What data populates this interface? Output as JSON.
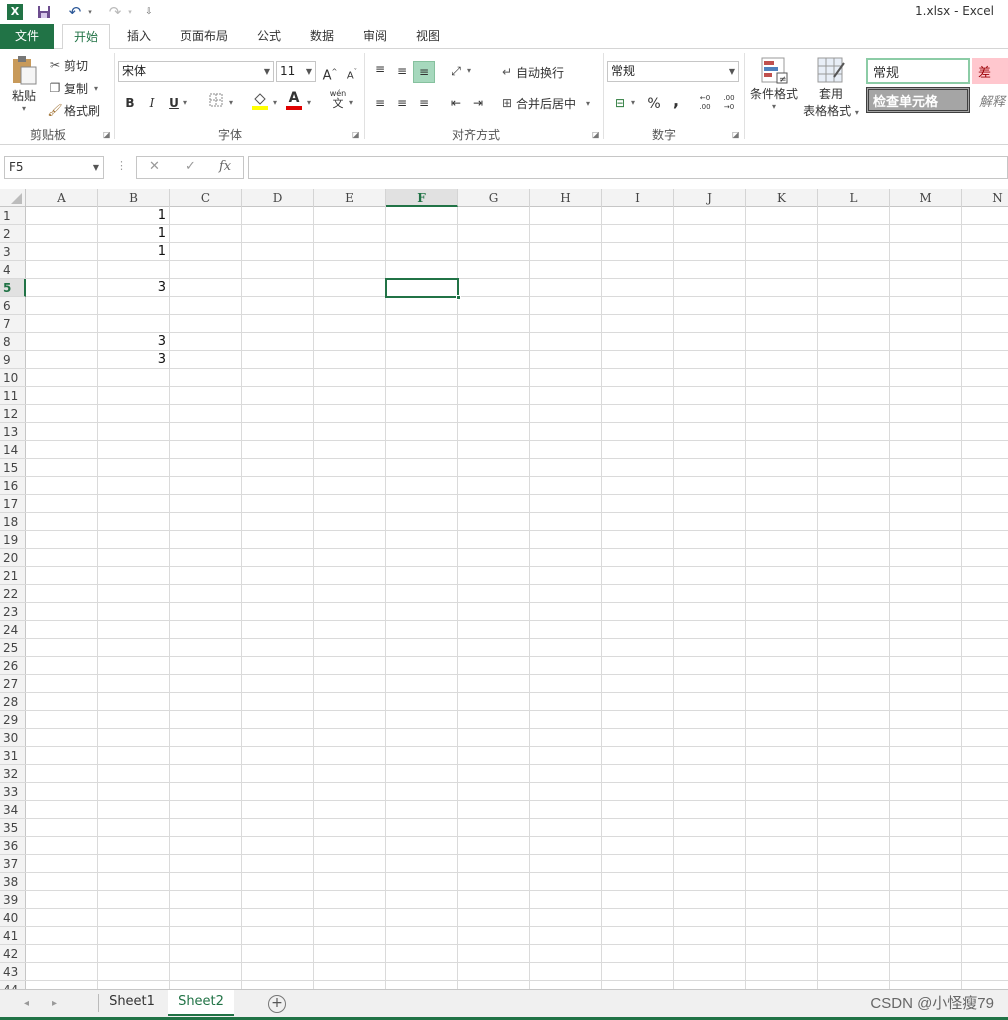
{
  "titlebar": {
    "title": "1.xlsx - Excel",
    "excel_logo": "X",
    "save_icon": "save-icon",
    "undo_glyph": "↶",
    "redo_glyph": "↷",
    "customize_glyph": "⇩"
  },
  "tabs": [
    "文件",
    "开始",
    "插入",
    "页面布局",
    "公式",
    "数据",
    "审阅",
    "视图"
  ],
  "ribbon": {
    "clipboard": {
      "paste": "粘贴",
      "cut": "剪切",
      "copy": "复制",
      "format_painter": "格式刷",
      "label": "剪贴板"
    },
    "font": {
      "name": "宋体",
      "size": "11",
      "grow": "A",
      "shrink": "A",
      "bold": "B",
      "italic": "I",
      "underline": "U",
      "wen": "wén",
      "wen_zi": "文",
      "label": "字体"
    },
    "alignment": {
      "wrap": "自动换行",
      "merge": "合并后居中",
      "label": "对齐方式"
    },
    "number": {
      "format": "常规",
      "percent": "%",
      "comma": ",",
      "inc_decimal": "←0 .00",
      "dec_decimal": ".00 →0",
      "label": "数字"
    },
    "styles": {
      "conditional": "条件格式",
      "table_format_line1": "套用",
      "table_format_line2": "表格格式",
      "normal": "常规",
      "bad": "差",
      "check_cell": "检查单元格",
      "explain": "解释"
    }
  },
  "formula_bar": {
    "namebox": "F5",
    "cancel": "✕",
    "enter": "✓",
    "fx": "fx",
    "value": ""
  },
  "columns": [
    "A",
    "B",
    "C",
    "D",
    "E",
    "F",
    "G",
    "H",
    "I",
    "J",
    "K",
    "L",
    "M",
    "N"
  ],
  "selected_column": "F",
  "rows": [
    "1",
    "2",
    "3",
    "4",
    "5",
    "6",
    "7",
    "8",
    "9",
    "10",
    "11",
    "12",
    "13",
    "14",
    "15",
    "16",
    "17",
    "18",
    "19",
    "20",
    "21",
    "22",
    "23",
    "24",
    "25",
    "26",
    "27",
    "28",
    "29",
    "30",
    "31",
    "32",
    "33",
    "34",
    "35",
    "36",
    "37",
    "38",
    "39",
    "40",
    "41",
    "42",
    "43",
    "44"
  ],
  "selected_row": "5",
  "cells": [
    {
      "ref": "B1",
      "value": "1"
    },
    {
      "ref": "B2",
      "value": "1"
    },
    {
      "ref": "B3",
      "value": "1"
    },
    {
      "ref": "B5",
      "value": "3"
    },
    {
      "ref": "B8",
      "value": "3"
    },
    {
      "ref": "B9",
      "value": "3"
    }
  ],
  "sheets": [
    "Sheet1",
    "Sheet2"
  ],
  "active_sheet": "Sheet2",
  "add_sheet": "+",
  "watermark": "CSDN @小怪瘦79",
  "colors": {
    "accent": "#217346",
    "bad_fill": "#ffc7ce",
    "bad_text": "#9c0006",
    "check_fill": "#a5a5a5"
  }
}
